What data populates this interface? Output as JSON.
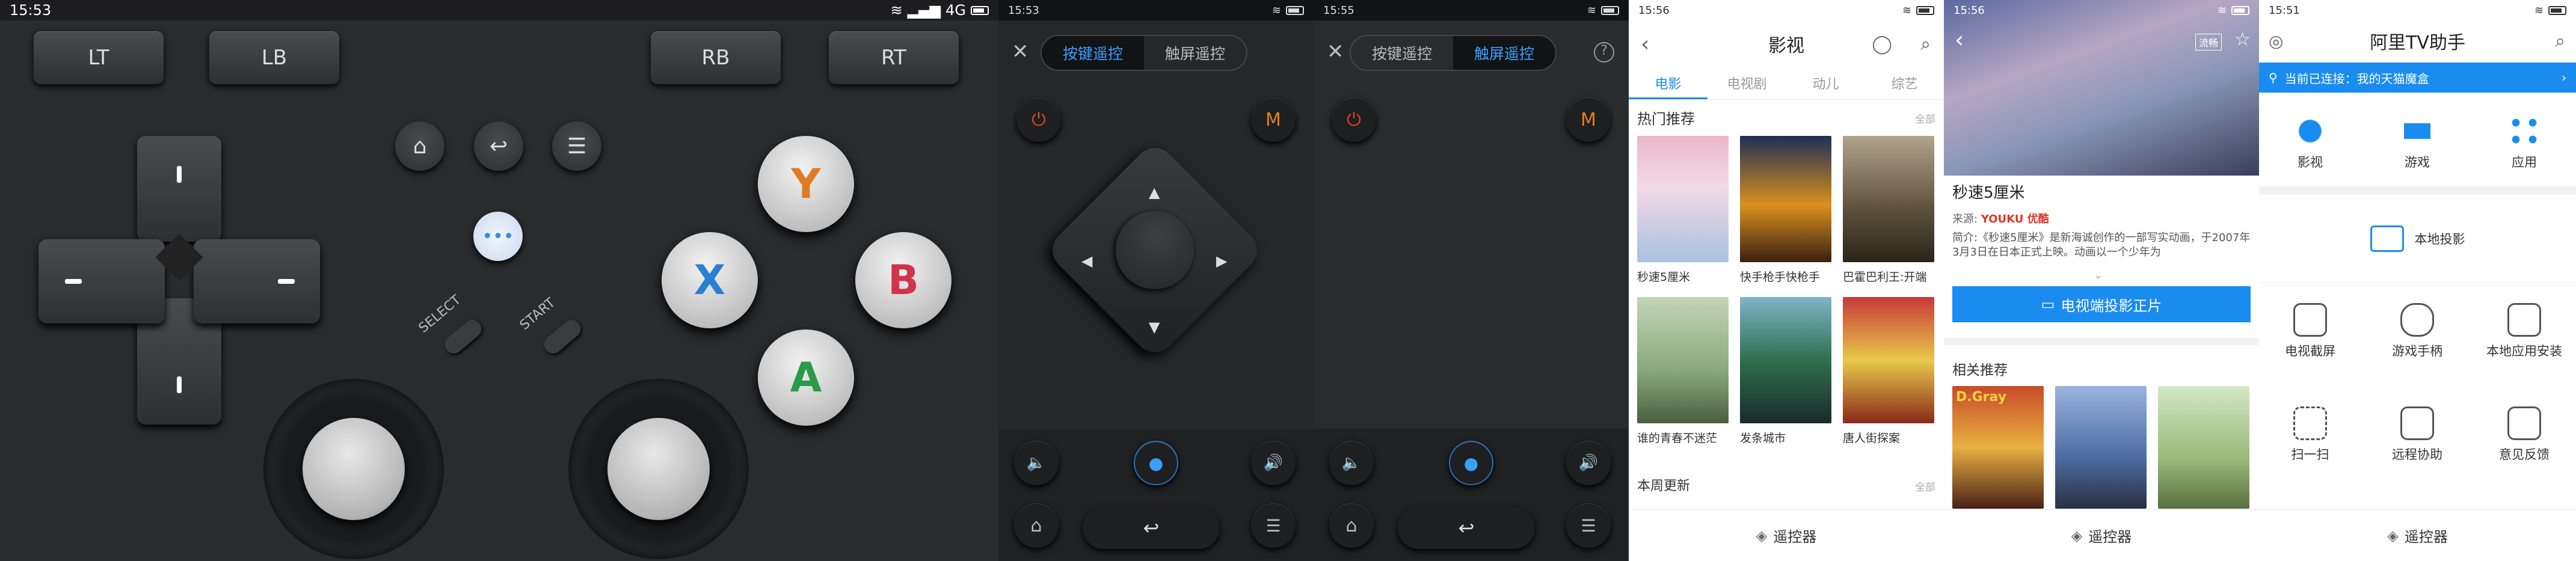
{
  "gamepad": {
    "status": {
      "time": "15:53",
      "network": "4G"
    },
    "shoulders": {
      "lt": "LT",
      "lb": "LB",
      "rb": "RB",
      "rt": "RT"
    },
    "buttons": {
      "y": "Y",
      "x": "X",
      "b": "B",
      "a": "A"
    },
    "select": "SELECT",
    "start": "START",
    "colors": {
      "y": "#e07a23",
      "x": "#2a7fd4",
      "b": "#d0334a",
      "a": "#2a9a48"
    }
  },
  "remote1": {
    "status": {
      "time": "15:53"
    },
    "tabs": [
      "按键遥控",
      "触屏遥控"
    ],
    "active_tab": 0,
    "m_label": "M"
  },
  "remote2": {
    "status": {
      "time": "15:55"
    },
    "tabs": [
      "按键遥控",
      "触屏遥控"
    ],
    "active_tab": 1,
    "m_label": "M"
  },
  "video": {
    "status": {
      "time": "15:56"
    },
    "title": "影视",
    "tabs": [
      "电影",
      "电视剧",
      "动儿",
      "综艺"
    ],
    "section1": "热门推荐",
    "more": "全部",
    "row1": [
      "秒速5厘米",
      "快手枪手快枪手",
      "巴霍巴利王:开端"
    ],
    "row2": [
      "谁的青春不迷茫",
      "发条城市",
      "唐人街探案"
    ],
    "section2": "本周更新",
    "nav": "遥控器"
  },
  "detail": {
    "status": {
      "time": "15:56"
    },
    "badge": "流畅",
    "title": "秒速5厘米",
    "source_label": "来源:",
    "source": "YOUKU 优酷",
    "desc": "简介:《秒速5厘米》是新海诚创作的一部写实动画，于2007年3月3日在日本正式上映。动画以一个少年为",
    "cta": "电视端投影正片",
    "related": "相关推荐",
    "related_poster": "D.Gray",
    "nav": "遥控器"
  },
  "assistant": {
    "status": {
      "time": "15:51"
    },
    "title": "阿里TV助手",
    "banner": "当前已连接：我的天猫魔盒",
    "top": [
      "影视",
      "游戏",
      "应用"
    ],
    "local": "本地投影",
    "grid": [
      "电视截屏",
      "游戏手柄",
      "本地应用安装",
      "扫一扫",
      "远程协助",
      "意见反馈"
    ],
    "nav": "遥控器",
    "accent": "#1a8cf0"
  }
}
